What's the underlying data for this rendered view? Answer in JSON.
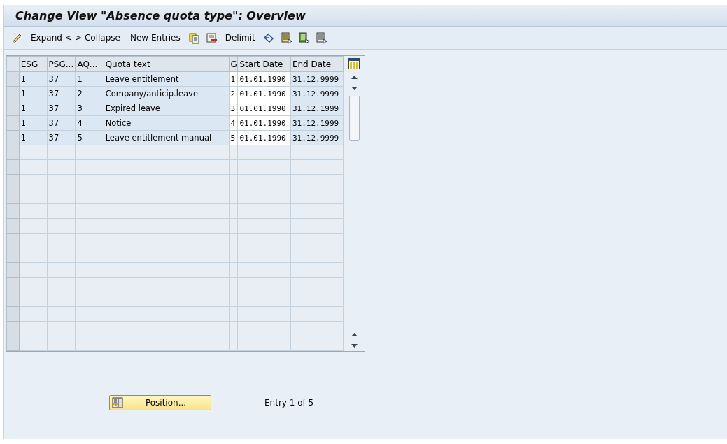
{
  "window": {
    "title": "Change View \"Absence quota type\": Overview"
  },
  "toolbar": {
    "items": [
      {
        "kind": "pencil"
      },
      {
        "kind": "text",
        "label": "Expand <-> Collapse"
      },
      {
        "kind": "text",
        "label": "New Entries"
      },
      {
        "kind": "copy"
      },
      {
        "kind": "delete"
      },
      {
        "kind": "text",
        "label": "Delimit"
      },
      {
        "kind": "undo"
      },
      {
        "kind": "selectall"
      },
      {
        "kind": "selectblock"
      },
      {
        "kind": "deselect"
      }
    ]
  },
  "table": {
    "columns": [
      "ESG",
      "PSG...",
      "AQ...",
      "Quota text",
      "G",
      "Start Date",
      "End Date"
    ],
    "rows": [
      {
        "cells": [
          "1",
          "37",
          "1",
          "Leave entitlement",
          "1",
          "01.01.1990",
          "31.12.9999"
        ]
      },
      {
        "cells": [
          "1",
          "37",
          "2",
          "Company/anticip.leave",
          "2",
          "01.01.1990",
          "31.12.9999"
        ]
      },
      {
        "cells": [
          "1",
          "37",
          "3",
          "Expired leave",
          "3",
          "01.01.1990",
          "31.12.1999"
        ]
      },
      {
        "cells": [
          "1",
          "37",
          "4",
          "Notice",
          "4",
          "01.01.1990",
          "31.12.1999"
        ]
      },
      {
        "cells": [
          "1",
          "37",
          "5",
          "Leave entitlement manual",
          "5",
          "01.01.1990",
          "31.12.9999"
        ]
      }
    ]
  },
  "footer": {
    "position_button": "Position...",
    "entry_info": "Entry 1 of 5"
  }
}
